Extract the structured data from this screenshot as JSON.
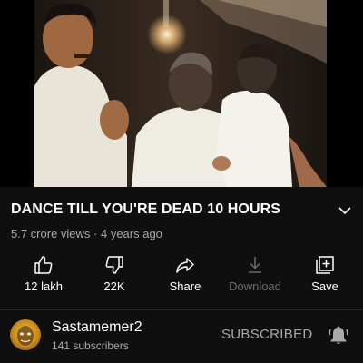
{
  "video": {
    "title": "DANCE TILL YOU'RE DEAD 10 HOURS",
    "views": "5.7 crore views",
    "age": "4 years ago",
    "separator": " · "
  },
  "actions": [
    {
      "label": "12 lakh",
      "icon": "thumbs-up-icon",
      "enabled": true
    },
    {
      "label": "22K",
      "icon": "thumbs-down-icon",
      "enabled": true
    },
    {
      "label": "Share",
      "icon": "share-icon",
      "enabled": true
    },
    {
      "label": "Download",
      "icon": "download-icon",
      "enabled": false
    },
    {
      "label": "Save",
      "icon": "add-to-playlist-icon",
      "enabled": true
    }
  ],
  "channel": {
    "name": "Sastamemer2",
    "subscribers": "141 subscribers",
    "subscribe_label": "SUBSCRIBED"
  },
  "colors": {
    "background": "#0f0f0f",
    "secondary_text": "#aaaaaa",
    "disabled_text": "#6b6b6b"
  }
}
